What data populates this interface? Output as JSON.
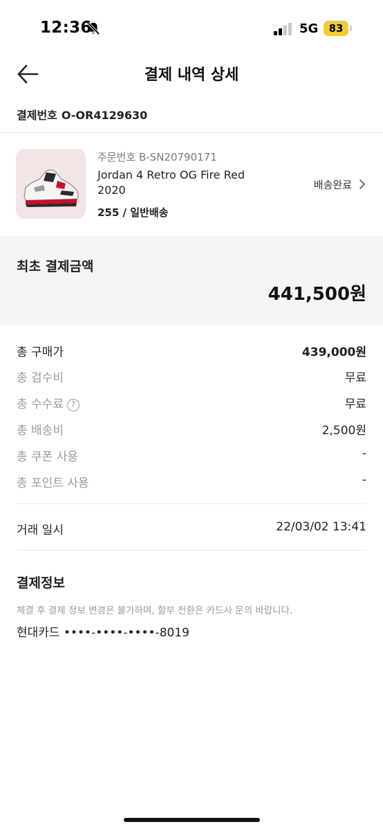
{
  "status_bar": {
    "time": "12:36",
    "network": "5G",
    "battery": "83"
  },
  "header": {
    "title": "결제 내역 상세"
  },
  "payment": {
    "label": "결제번호",
    "number": "O-OR4129630"
  },
  "order": {
    "order_no": "주문번호 B-SN20790171",
    "product_name": "Jordan 4 Retro OG Fire Red 2020",
    "option": "255 / 일반배송",
    "status": "배송완료"
  },
  "summary": {
    "label": "최초 결제금액",
    "amount": "441,500원"
  },
  "breakdown": [
    {
      "label": "총 구매가",
      "value": "439,000원"
    },
    {
      "label": "총 검수비",
      "value": "무료"
    },
    {
      "label": "총 수수료",
      "value": "무료"
    },
    {
      "label": "총 배송비",
      "value": "2,500원"
    },
    {
      "label": "총 쿠폰 사용",
      "value": "-"
    },
    {
      "label": "총 포인트 사용",
      "value": "-"
    }
  ],
  "transaction": {
    "label": "거래 일시",
    "value": "22/03/02 13:41"
  },
  "payment_info": {
    "title": "결제정보",
    "notice": "체결 후 결제 정보 변경은 불가하며, 할부 전환은 카드사 문의 바랍니다.",
    "card": "현대카드 ••••-••••-••••-8019"
  },
  "colors": {
    "summary_bg": "#f5f5f5",
    "battery": "#f2cb3a",
    "muted_text": "#9a9a9a",
    "product_bg": "#f4e4e4"
  },
  "icons": [
    "bell-slash-icon",
    "signal-icon",
    "back-arrow-icon",
    "chevron-right-icon",
    "help-icon",
    "sneaker-image"
  ]
}
